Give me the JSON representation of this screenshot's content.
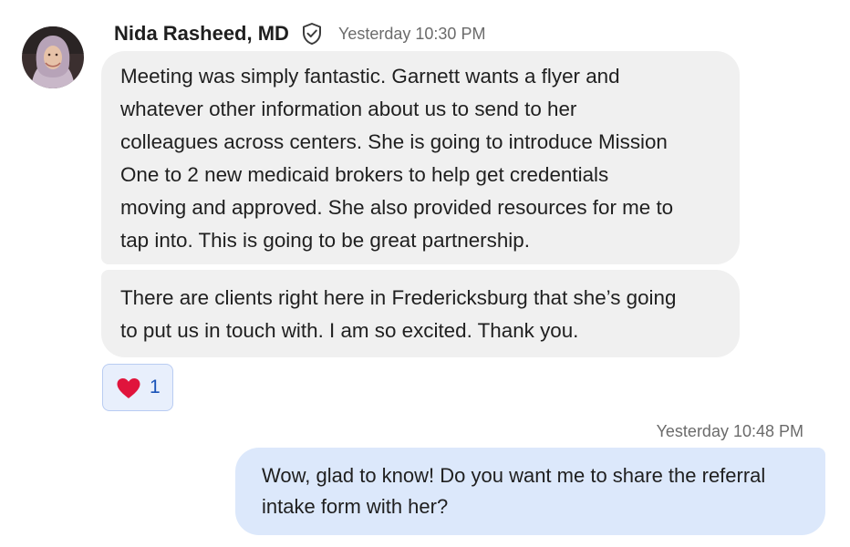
{
  "conversation": {
    "incoming": {
      "sender_name": "Nida Rasheed, MD",
      "verified_icon": "shield-check-icon",
      "timestamp": "Yesterday 10:30 PM",
      "messages": [
        {
          "text": "Meeting was simply fantastic.  Garnett wants a flyer and\nwhatever other information about us to send to her\ncolleagues across centers.  She is going to introduce Mission\nOne to 2 new medicaid brokers to help get credentials\nmoving and approved. She also provided resources for me to\ntap into.  This is going to be great partnership."
        },
        {
          "text": "There are clients right here in Fredericksburg that she’s going\nto put us in touch with.  I am so excited.  Thank you."
        }
      ],
      "reaction": {
        "icon": "heart-icon",
        "count": "1"
      }
    },
    "outgoing": {
      "timestamp": "Yesterday 10:48 PM",
      "text": "Wow, glad to know! Do you want me to share the referral\nintake form with her?"
    }
  },
  "colors": {
    "incoming_bubble": "#f0f0f0",
    "outgoing_bubble": "#dce8fb",
    "reaction_bg": "#e8effc",
    "reaction_border": "#b9ccf2",
    "heart": "#e0143c",
    "reaction_count": "#1a53b8"
  }
}
